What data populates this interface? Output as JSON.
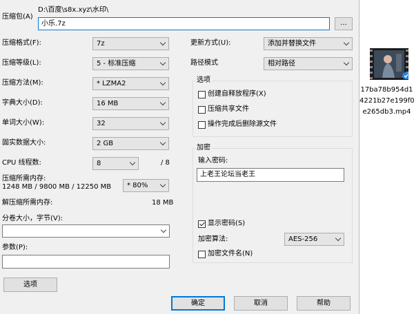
{
  "archive": {
    "label": "压缩包(A)",
    "path": "D:\\百度\\s8x.xyz\\水印\\",
    "value": "小乐.7z",
    "browse_label": "..."
  },
  "left": {
    "format": {
      "label": "压缩格式(F):",
      "value": "7z"
    },
    "level": {
      "label": "压缩等级(L):",
      "value": "5 - 标准压缩"
    },
    "method": {
      "label": "压缩方法(M):",
      "value": "*  LZMA2"
    },
    "dict": {
      "label": "字典大小(D):",
      "value": "16 MB"
    },
    "word": {
      "label": "单词大小(W):",
      "value": "32"
    },
    "solid": {
      "label": "固实数据大小:",
      "value": "2 GB"
    },
    "cpu": {
      "label": "CPU 线程数:",
      "value": "8",
      "total": "/ 8"
    },
    "mem_compress": {
      "label": "压缩所需内存:",
      "detail": "1248 MB / 9800 MB / 12250 MB",
      "value": "* 80%"
    },
    "mem_decompress": {
      "label": "解压缩所需内存:",
      "value": "18 MB"
    },
    "volume": {
      "label": "分卷大小，字节(V):",
      "value": ""
    },
    "params": {
      "label": "参数(P):",
      "value": ""
    },
    "options_button": "选项"
  },
  "right": {
    "update": {
      "label": "更新方式(U):",
      "value": "添加并替换文件"
    },
    "pathmode": {
      "label": "路径模式",
      "value": "相对路径"
    },
    "options": {
      "title": "选项",
      "sfx": "创建自释放程序(X)",
      "shared": "压缩共享文件",
      "delete": "操作完成后删除源文件"
    },
    "encryption": {
      "title": "加密",
      "password_label": "输入密码:",
      "password_value": "上老王论坛当老王",
      "show_password": "显示密码(S)",
      "method_label": "加密算法:",
      "method_value": "AES-256",
      "encrypt_names": "加密文件名(N)"
    }
  },
  "buttons": {
    "ok": "确定",
    "cancel": "取消",
    "help": "帮助"
  },
  "desktop_file": {
    "name_line1": "17ba78b954d1",
    "name_line2": "4221b27e199f0",
    "name_line3": "e265db3.mp4"
  }
}
